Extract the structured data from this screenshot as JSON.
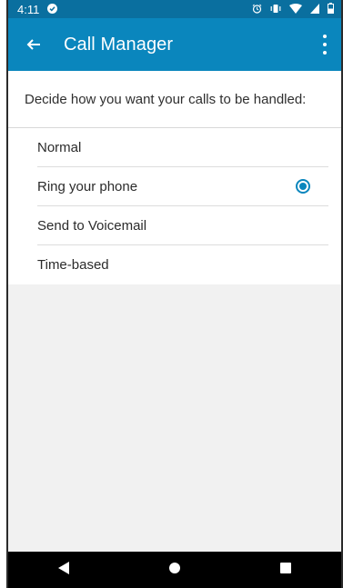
{
  "status_bar": {
    "time": "4:11",
    "left_icon": "notification-check-icon",
    "right_icons": [
      "alarm-clock-icon",
      "vibrate-icon",
      "wifi-icon",
      "cellular-signal-icon",
      "battery-icon"
    ]
  },
  "app_bar": {
    "title": "Call Manager",
    "back_icon": "back-arrow-icon",
    "menu_icon": "overflow-menu-icon"
  },
  "prompt": "Decide how you want your calls to be handled:",
  "options": [
    {
      "label": "Normal",
      "selected": false
    },
    {
      "label": "Ring your phone",
      "selected": true
    },
    {
      "label": "Send to Voicemail",
      "selected": false
    },
    {
      "label": "Time-based",
      "selected": false
    }
  ],
  "nav_bar": {
    "back": "nav-back-icon",
    "home": "nav-home-icon",
    "recents": "nav-recents-icon"
  },
  "colors": {
    "status_bar": "#0a6f9f",
    "app_bar": "#0a86bd",
    "accent": "#0a86bd"
  }
}
